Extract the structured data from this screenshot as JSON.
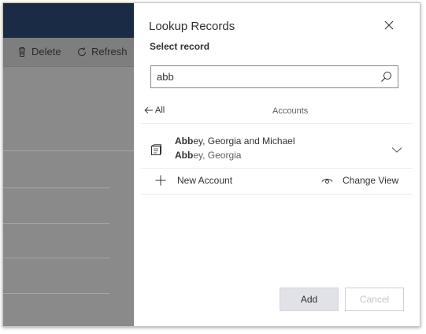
{
  "background_app": {
    "commands": [
      {
        "label": "Delete",
        "icon": "trash-icon"
      },
      {
        "label": "Refresh",
        "icon": "refresh-icon"
      }
    ]
  },
  "dialog": {
    "title": "Lookup Records",
    "subtitle": "Select record",
    "search": {
      "value": "abb",
      "placeholder": ""
    },
    "back_label": "All",
    "entity_label": "Accounts",
    "results": [
      {
        "primary_match": "Abb",
        "primary_rest": "ey, Georgia and Michael",
        "secondary_match": "Abb",
        "secondary_rest": "ey, Georgia"
      }
    ],
    "new_record_label": "New Account",
    "change_view_label": "Change View",
    "buttons": {
      "add": "Add",
      "cancel": "Cancel"
    }
  },
  "colors": {
    "overlay": "#8a8a8a",
    "topbar": "#1a2c45",
    "add_button_bg": "#e1e2e7",
    "disabled_text": "#c8c6c4"
  }
}
